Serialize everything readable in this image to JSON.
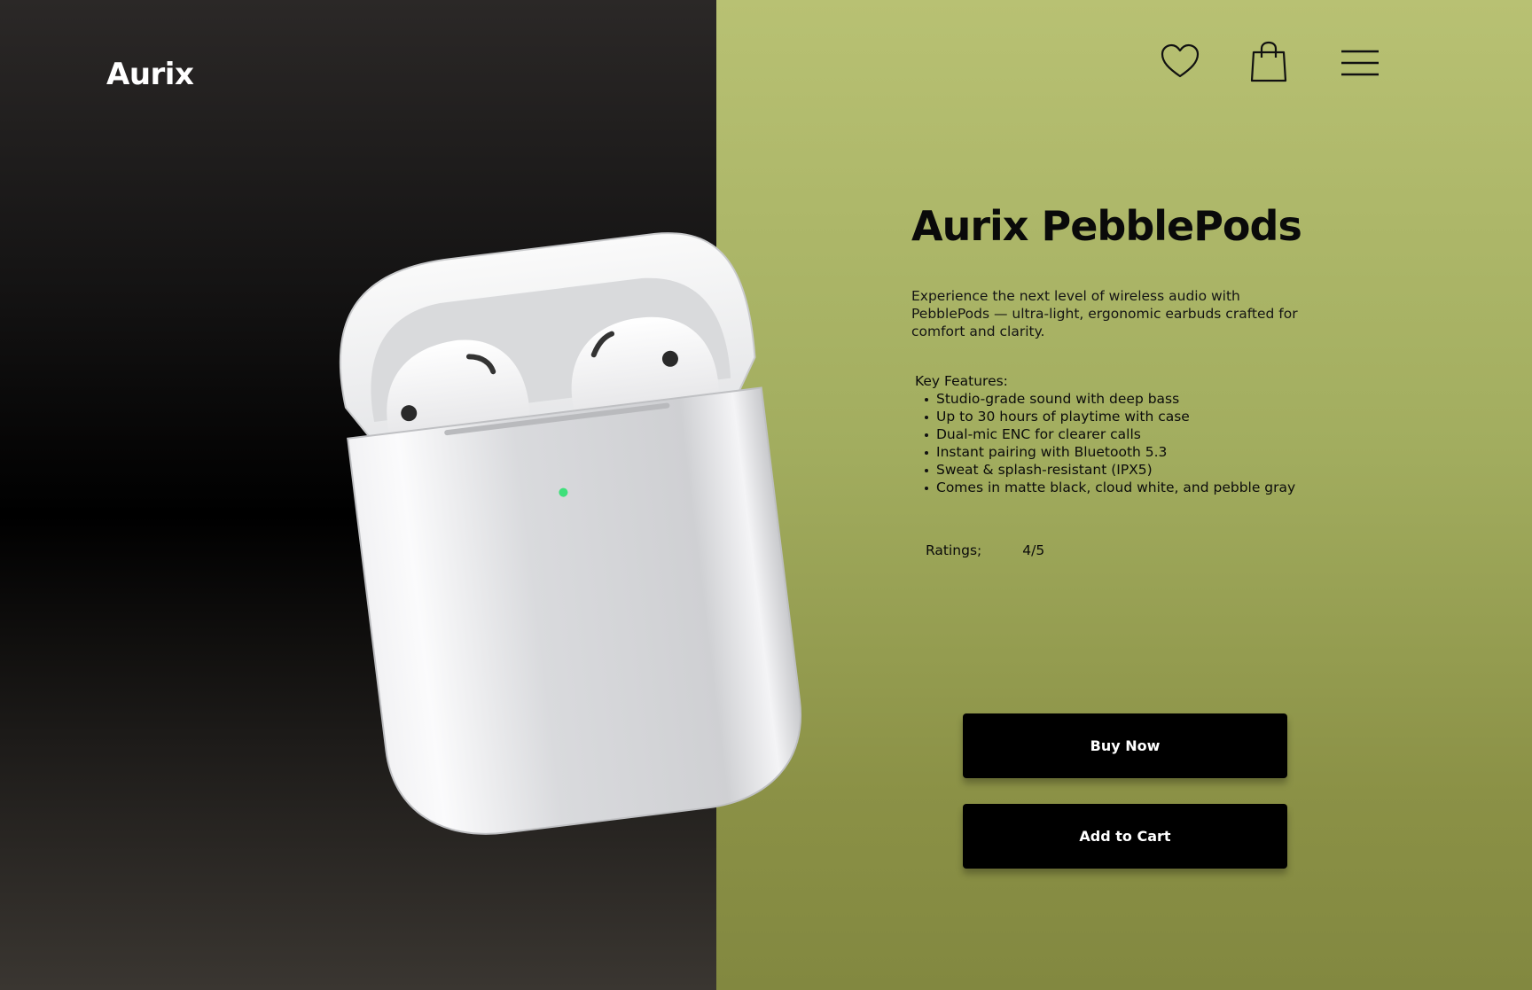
{
  "brand": "Aurix",
  "nav": {
    "icons": [
      "heart-icon",
      "shopping-bag-icon",
      "hamburger-menu-icon"
    ]
  },
  "product": {
    "title": "Aurix PebblePods",
    "description": "Experience the next level of wireless audio with PebblePods — ultra-light, ergonomic earbuds crafted for comfort and clarity.",
    "features_label": "Key Features:",
    "features": [
      "Studio-grade sound with deep bass",
      "Up to 30 hours of playtime with case",
      "Dual-mic ENC for clearer calls",
      "Instant pairing with Bluetooth 5.3",
      "Sweat & splash-resistant (IPX5)",
      "Comes in matte black, cloud white, and pebble gray"
    ],
    "ratings_label": "Ratings;",
    "rating_value": "4/5"
  },
  "actions": {
    "buy_label": "Buy Now",
    "cart_label": "Add to Cart"
  },
  "colors": {
    "left_panel": "#000000",
    "right_panel": "#a2ad5f",
    "button_bg": "#000000",
    "button_text": "#ffffff",
    "case_led": "#3ee07a"
  }
}
